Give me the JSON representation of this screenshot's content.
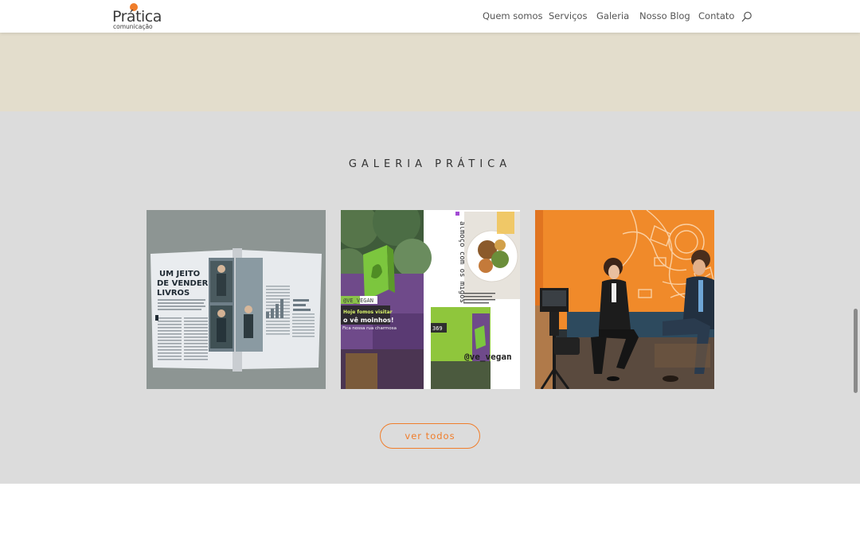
{
  "header": {
    "logo": {
      "main": "Prática",
      "sub": "comunicação"
    },
    "nav": [
      "Quem somos",
      "Serviços",
      "Galeria",
      "Nosso Blog",
      "Contato"
    ]
  },
  "gallery": {
    "title": "GALERIA PRÁTICA",
    "images": {
      "magazine": {
        "headline_lines": [
          "UM JEITO",
          "DE VENDER",
          "LIVROS"
        ]
      },
      "vegan": {
        "side_text": "almoço com os migos",
        "tag": "@VE_VEGAN",
        "banner_lines": [
          "Hoje fomos visitar",
          "o vê moinhos!"
        ],
        "caption": "Fica nossa rua charmosa",
        "number": "369",
        "handle": "@ve_vegan"
      }
    },
    "button_label": "ver todos"
  },
  "colors": {
    "accent": "#f07d2a",
    "beige": "#e3ddcc",
    "gallery_bg": "#dcdcdc"
  }
}
